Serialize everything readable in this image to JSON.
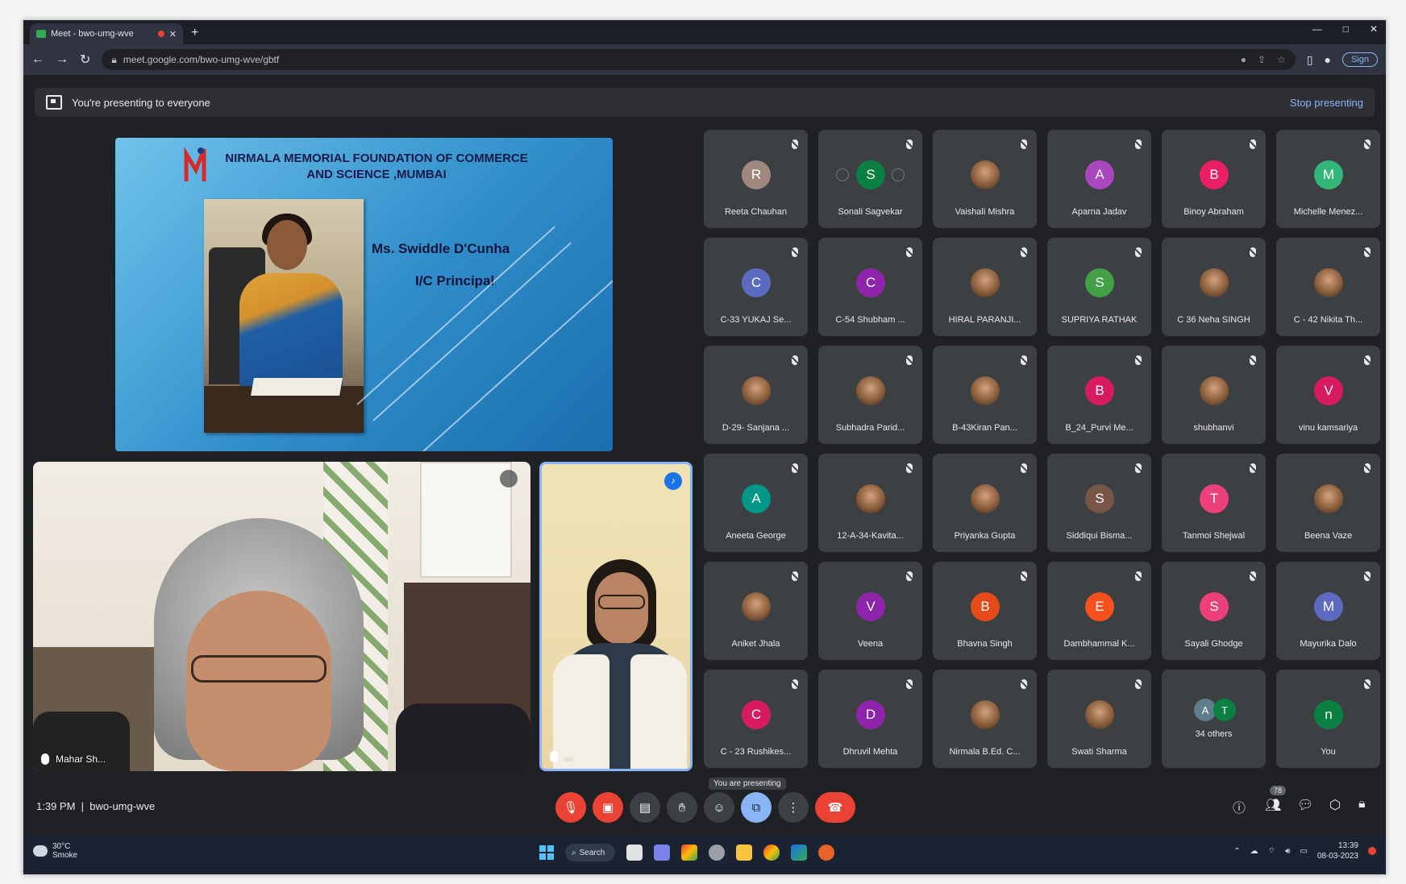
{
  "browser": {
    "tab_title": "Meet - bwo-umg-wve",
    "url": "meet.google.com/bwo-umg-wve/gbtf",
    "window_controls": [
      "—",
      "□",
      "✕"
    ],
    "profile_label": "Sign"
  },
  "presenting_bar": {
    "message": "You're presenting to everyone",
    "stop_label": "Stop presenting"
  },
  "slide": {
    "title_line1": "NIRMALA MEMORIAL FOUNDATION OF COMMERCE",
    "title_line2": "AND SCIENCE ,MUMBAI",
    "person_name": "Ms. Swiddle D'Cunha",
    "person_role": "I/C Principal"
  },
  "videos": {
    "main_name": "Mahar Sh...",
    "side_name": "..."
  },
  "participants": [
    {
      "name": "Reeta Chauhan",
      "initial": "R",
      "color": "#a1887f",
      "photo": false
    },
    {
      "name": "Sonali Sagvekar",
      "initial": "S",
      "color": "#0b8043",
      "photo": false
    },
    {
      "name": "Vaishali Mishra",
      "initial": "",
      "color": "",
      "photo": true
    },
    {
      "name": "Aparna Jadav",
      "initial": "A",
      "color": "#ab47bc",
      "photo": false
    },
    {
      "name": "Binoy Abraham",
      "initial": "B",
      "color": "#e91e63",
      "photo": false
    },
    {
      "name": "Michelle Menez...",
      "initial": "M",
      "color": "#33b679",
      "photo": false
    },
    {
      "name": "C-33 YUKAJ Se...",
      "initial": "C",
      "color": "#5c6bc0",
      "photo": false
    },
    {
      "name": "C-54 Shubham ...",
      "initial": "C",
      "color": "#8e24aa",
      "photo": false
    },
    {
      "name": "HIRAL PARANJI...",
      "initial": "",
      "color": "",
      "photo": true
    },
    {
      "name": "SUPRIYA RATHAK",
      "initial": "S",
      "color": "#43a047",
      "photo": false
    },
    {
      "name": "C 36 Neha SINGH",
      "initial": "",
      "color": "",
      "photo": true
    },
    {
      "name": "C - 42 Nikita Th...",
      "initial": "",
      "color": "",
      "photo": true
    },
    {
      "name": "D-29- Sanjana ...",
      "initial": "",
      "color": "",
      "photo": true
    },
    {
      "name": "Subhadra Parid...",
      "initial": "",
      "color": "",
      "photo": true
    },
    {
      "name": "B-43Kiran Pan...",
      "initial": "",
      "color": "",
      "photo": true
    },
    {
      "name": "B_24_Purvi Me...",
      "initial": "B",
      "color": "#d81b60",
      "photo": false
    },
    {
      "name": "shubhanvi",
      "initial": "",
      "color": "",
      "photo": true
    },
    {
      "name": "vinu kamsariya",
      "initial": "V",
      "color": "#d81b60",
      "photo": false
    },
    {
      "name": "Aneeta George",
      "initial": "A",
      "color": "#009688",
      "photo": false
    },
    {
      "name": "12-A-34-Kavita...",
      "initial": "",
      "color": "",
      "photo": true
    },
    {
      "name": "Priyanka Gupta",
      "initial": "",
      "color": "",
      "photo": true
    },
    {
      "name": "Siddiqui Bisma...",
      "initial": "S",
      "color": "#795548",
      "photo": false
    },
    {
      "name": "Tanmoi Shejwal",
      "initial": "T",
      "color": "#ec407a",
      "photo": false
    },
    {
      "name": "Beena Vaze",
      "initial": "",
      "color": "",
      "photo": true
    },
    {
      "name": "Aniket Jhala",
      "initial": "",
      "color": "",
      "photo": true
    },
    {
      "name": "Veena",
      "initial": "V",
      "color": "#8e24aa",
      "photo": false
    },
    {
      "name": "Bhavna Singh",
      "initial": "B",
      "color": "#e64a19",
      "photo": false
    },
    {
      "name": "Dambhammal K...",
      "initial": "E",
      "color": "#f4511e",
      "photo": false
    },
    {
      "name": "Sayali Ghodge",
      "initial": "S",
      "color": "#ec407a",
      "photo": false
    },
    {
      "name": "Mayurika Dalo",
      "initial": "M",
      "color": "#5c6bc0",
      "photo": false
    },
    {
      "name": "C - 23 Rushikes...",
      "initial": "C",
      "color": "#d81b60",
      "photo": false
    },
    {
      "name": "Dhruvil Mehta",
      "initial": "D",
      "color": "#8e24aa",
      "photo": false
    },
    {
      "name": "Nirmala B.Ed. C...",
      "initial": "",
      "color": "",
      "photo": true
    },
    {
      "name": "Swati Sharma",
      "initial": "",
      "color": "",
      "photo": true
    },
    {
      "name": "34 others",
      "initial": "",
      "color": "",
      "photo": false
    },
    {
      "name": "You",
      "initial": "n",
      "color": "#0b8043",
      "photo": false
    }
  ],
  "controls": {
    "time": "1:39 PM",
    "meeting_code": "bwo-umg-wve",
    "tooltip": "You are presenting",
    "people_badge": "78"
  },
  "taskbar": {
    "weather_temp": "30°C",
    "weather_desc": "Smoke",
    "search_label": "Search",
    "clock_time": "13:39",
    "clock_date": "08-03-2023"
  }
}
